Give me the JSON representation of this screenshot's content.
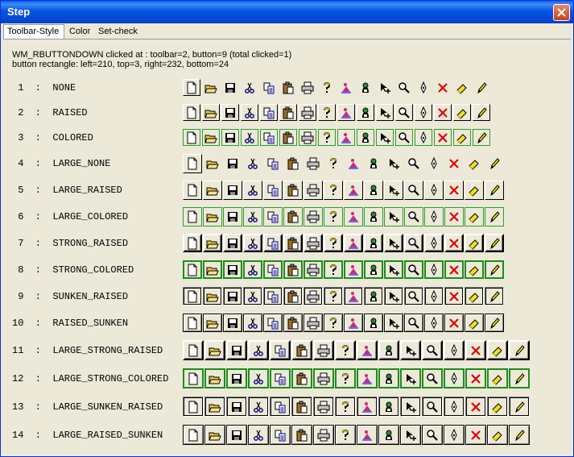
{
  "window": {
    "title": "Step"
  },
  "tabs": [
    {
      "label": "Toolbar-Style",
      "active": true
    },
    {
      "label": "Color",
      "active": false
    },
    {
      "label": "Set-check",
      "active": false
    }
  ],
  "status": {
    "line1": "WM_RBUTTONDOWN clicked at : toolbar=2, button=9 (total clicked=1)",
    "line2": "button rectangle: left=210, top=3, right=232, bottom=24"
  },
  "icons": [
    "new-icon",
    "open-folder-icon",
    "save-icon",
    "cut-icon",
    "copy-icon",
    "paste-icon",
    "print-icon",
    "help-icon",
    "pink-figure-icon",
    "portrait-icon",
    "pointer-plus-icon",
    "magnifier-icon",
    "pen-icon",
    "delete-x-icon",
    "eraser-icon",
    "pencil-icon"
  ],
  "rows": [
    {
      "label": " 1  :  NONE",
      "style": "none"
    },
    {
      "label": " 2  :  RAISED",
      "style": "raised"
    },
    {
      "label": " 3  :  COLORED",
      "style": "colored"
    },
    {
      "label": " 4  :  LARGE_NONE",
      "style": "none"
    },
    {
      "label": " 5  :  LARGE_RAISED",
      "style": "raised"
    },
    {
      "label": " 6  :  LARGE_COLORED",
      "style": "colored"
    },
    {
      "label": " 7  :  STRONG_RAISED",
      "style": "strong"
    },
    {
      "label": " 8  :  STRONG_COLORED",
      "style": "strongcol"
    },
    {
      "label": " 9  :  SUNKEN_RAISED",
      "style": "sunkenraised"
    },
    {
      "label": "10  :  RAISED_SUNKEN",
      "style": "raisedsunken"
    },
    {
      "label": "11  :  LARGE_STRONG_RAISED",
      "style": "strong"
    },
    {
      "label": "12  :  LARGE_STRONG_COLORED",
      "style": "strongcol"
    },
    {
      "label": "13  :  LARGE_SUNKEN_RAISED",
      "style": "sunkenraised"
    },
    {
      "label": "14  :  LARGE_RAISED_SUNKEN",
      "style": "raisedsunken"
    }
  ]
}
